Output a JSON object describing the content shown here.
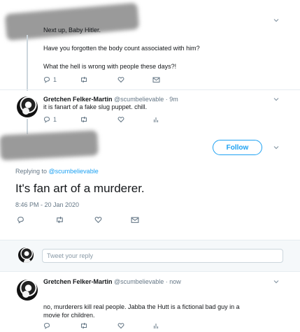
{
  "top_tweet": {
    "lines": [
      "Next up, Baby Hitler.",
      "Have you forgotten the body count associated with him?",
      "What the hell is wrong with people these days?!"
    ],
    "reply_count": "1"
  },
  "reply1": {
    "name": "Gretchen Felker-Martin",
    "handle_time": "@scumbelievable · 9m",
    "text": "it is fanart of a fake slug puppet. chill.",
    "reply_count": "1"
  },
  "main_tweet": {
    "follow_label": "Follow",
    "replying_prefix": "Replying to ",
    "replying_handle": "@scumbelievable",
    "text": "It's fan art of a murderer.",
    "timestamp": "8:46 PM - 20 Jan 2020"
  },
  "reply_box": {
    "placeholder": "Tweet your reply"
  },
  "reply2": {
    "name": "Gretchen Felker-Martin",
    "handle_time": "@scumbelievable · now",
    "text": "no, murderers kill real people. Jabba the Hutt is a fictional bad guy in a movie for children."
  }
}
